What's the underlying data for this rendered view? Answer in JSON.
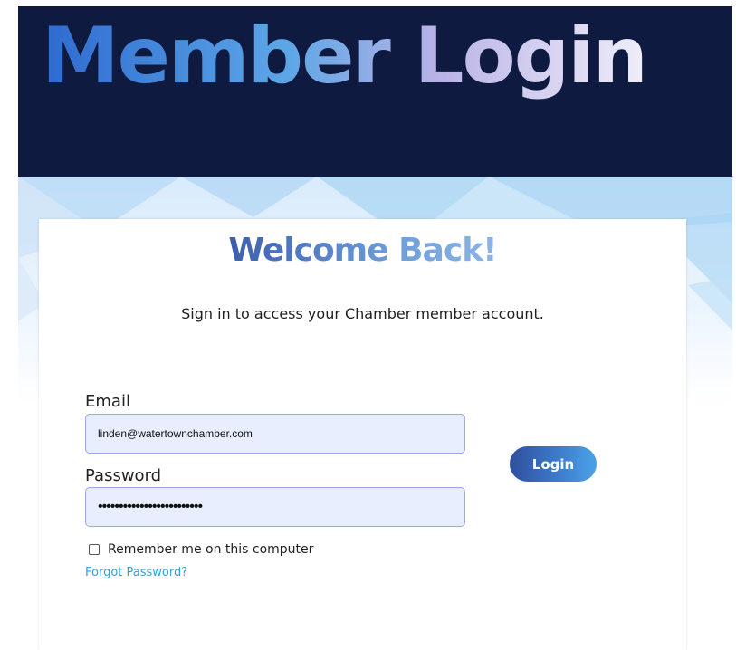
{
  "header": {
    "title": "Member Login"
  },
  "card": {
    "heading": "Welcome Back!",
    "subtitle": "Sign in to access your Chamber member account.",
    "email": {
      "label": "Email",
      "value": "linden@watertownchamber.com"
    },
    "password": {
      "label": "Password",
      "value": "•••••••••••••••••••••••••"
    },
    "remember_label": "Remember me on this computer",
    "remember_checked": false,
    "forgot_password_link": "Forgot Password?",
    "login_button": "Login"
  },
  "colors": {
    "header_bg": "#0e1a40",
    "accent_blue": "#3e7fcf",
    "link": "#2ea4d8",
    "input_bg": "#e8eefe"
  }
}
